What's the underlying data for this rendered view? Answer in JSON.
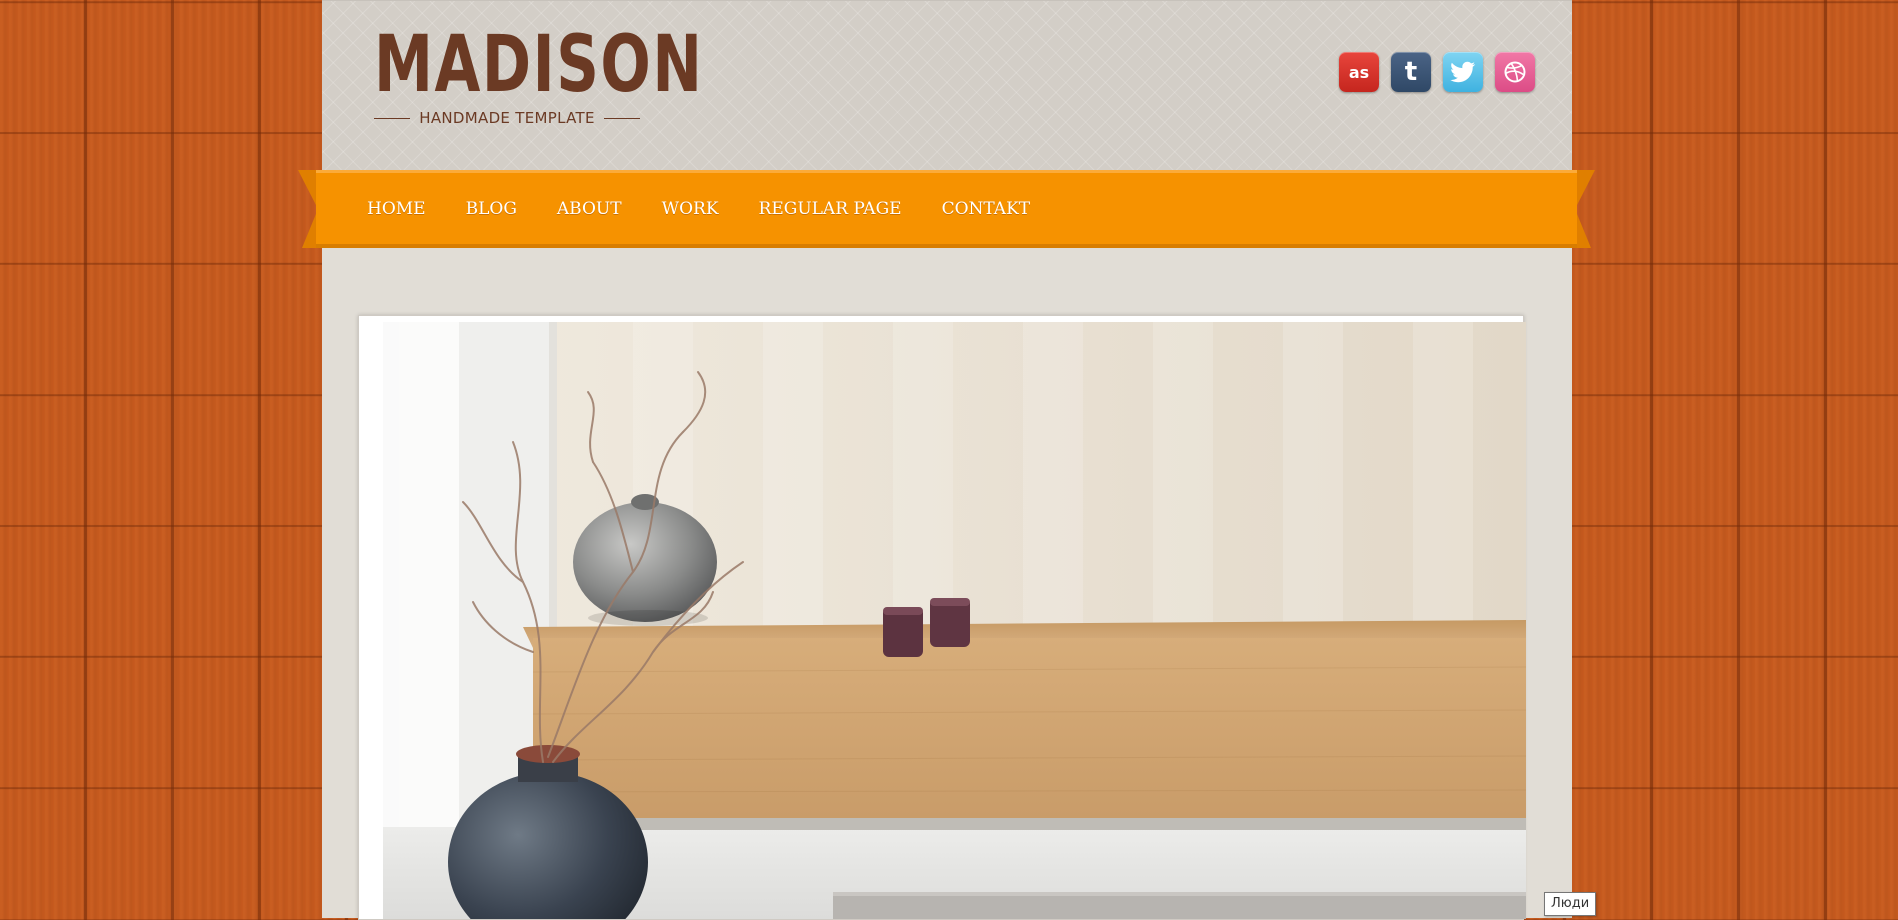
{
  "logo": {
    "title": "MADISON",
    "tagline": "HANDMADE TEMPLATE"
  },
  "social": [
    {
      "name": "lastfm",
      "glyph": "as",
      "color": "#d8322a"
    },
    {
      "name": "tumblr",
      "glyph": "t",
      "color": "#3b5476"
    },
    {
      "name": "twitter",
      "color": "#55bde6"
    },
    {
      "name": "dribbble",
      "color": "#e25c92"
    }
  ],
  "nav": {
    "items": [
      {
        "label": "HOME"
      },
      {
        "label": "BLOG"
      },
      {
        "label": "ABOUT"
      },
      {
        "label": "WORK"
      },
      {
        "label": "REGULAR PAGE"
      },
      {
        "label": "CONTAKT"
      }
    ],
    "color": "#f69200"
  },
  "hero": {
    "subject": "interior-photo-vases-wooden-bench"
  },
  "tooltip": {
    "text": "Люди"
  },
  "colors": {
    "wood": "#c65a1e",
    "page": "#e1ddd6",
    "header": "#d3cec7",
    "brand": "#6b3a24",
    "accent": "#f69200"
  }
}
